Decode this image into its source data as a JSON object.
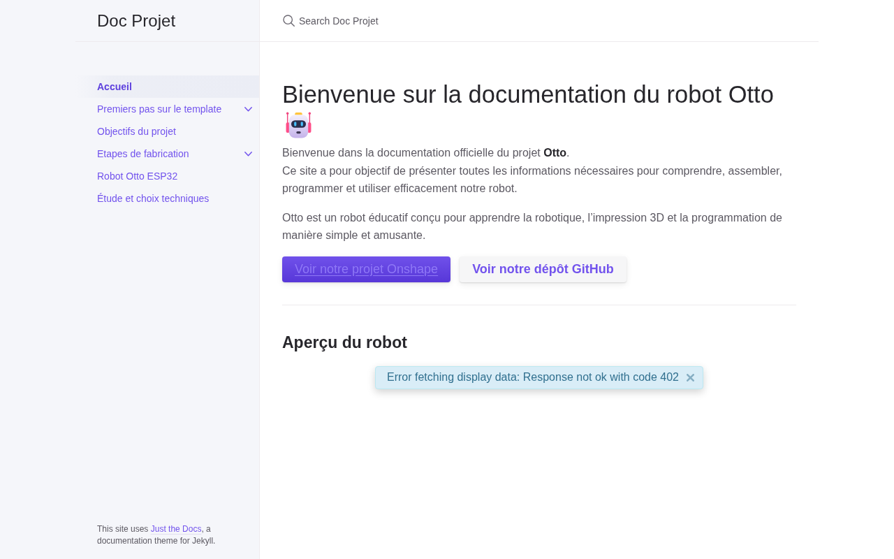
{
  "sidebar": {
    "site_title": "Doc Projet",
    "nav": [
      {
        "label": "Accueil",
        "kind": "page",
        "selected": true
      },
      {
        "label": "Premiers pas sur le template",
        "kind": "section",
        "selected": false,
        "expanded": false
      },
      {
        "label": "Objectifs du projet",
        "kind": "page",
        "selected": false
      },
      {
        "label": "Etapes de fabrication",
        "kind": "section",
        "selected": false,
        "expanded": false
      },
      {
        "label": "Robot Otto ESP32",
        "kind": "page",
        "selected": false
      },
      {
        "label": "Étude et choix techniques",
        "kind": "page",
        "selected": false
      }
    ],
    "footer": {
      "before": "This site uses ",
      "link": "Just the Docs",
      "after": ", a documentation theme for Jekyll."
    }
  },
  "search": {
    "placeholder": "Search Doc Projet"
  },
  "content": {
    "title": "Bienvenue sur la documentation du robot Otto",
    "paragraphs": [
      "Bienvenue dans la documentation officielle du projet **Otto**.\nCe site a pour objectif de présenter toutes les informations nécessaires pour comprendre, assembler, programmer et utiliser efficacement notre robot.",
      "Otto est un robot éducatif conçu pour apprendre la robotique, l’impression 3D et la programmation de manière simple et amusante."
    ],
    "buttons": [
      {
        "label": "Voir notre projet Onshape",
        "kind": "primary"
      },
      {
        "label": "Voir notre dépôt GitHub",
        "kind": "secondary"
      }
    ],
    "section_heading": "Aperçu du robot",
    "embed": {
      "error_message": "Error fetching display data: Response not ok with code 402"
    }
  }
}
